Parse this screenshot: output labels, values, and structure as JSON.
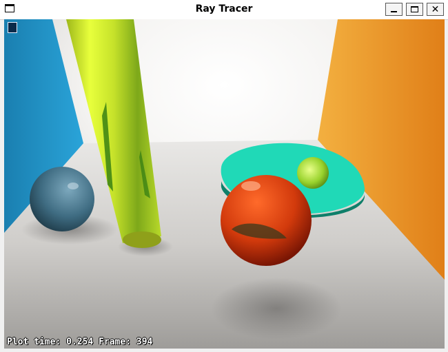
{
  "window": {
    "title": "Ray Tracer",
    "minimize_icon": "minimize-icon",
    "maximize_icon": "maximize-icon",
    "close_icon": "close-icon",
    "close_glyph": "✕"
  },
  "render": {
    "description_colors": {
      "left_wall": "#1c93c9",
      "right_wall": "#f09a2a",
      "back_wall": "#f2f1ef",
      "floor": "#cfcdca",
      "disk": "#20d9b7",
      "cylinder": "#c6e22a",
      "red_sphere": "#d23a0c",
      "blue_sphere": "#3f6c82",
      "green_sphere": "#98d22c"
    }
  },
  "status": {
    "plot_time_label": "Plot time:",
    "plot_time_value": "0.254",
    "frame_label": "Frame:",
    "frame_value": "394"
  }
}
